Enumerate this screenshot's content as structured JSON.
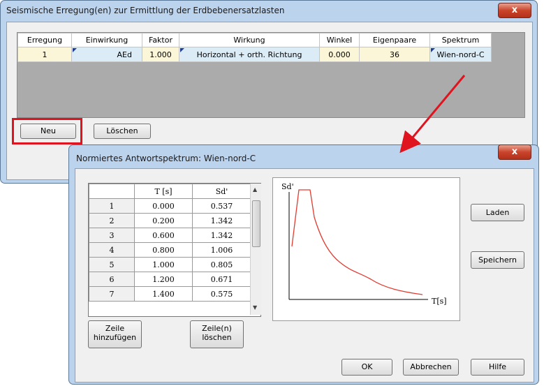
{
  "main_window": {
    "title": "Seismische Erregung(en) zur Ermittlung der Erdbebenersatzlasten",
    "close": "x",
    "columns": [
      "Erregung",
      "Einwirkung",
      "Faktor",
      "Wirkung",
      "Winkel",
      "Eigenpaare",
      "Spektrum"
    ],
    "row": [
      "1",
      "AEd",
      "1.000",
      "Horizontal + orth. Richtung",
      "0.000",
      "36",
      "Wien-nord-C"
    ],
    "buttons": {
      "new": "Neu",
      "delete": "Löschen"
    }
  },
  "dialog": {
    "title": "Normiertes Antwortspektrum: Wien-nord-C",
    "close": "x",
    "table": {
      "headers": [
        "",
        "T [s]",
        "Sd'"
      ],
      "rows": [
        [
          "1",
          "0.000",
          "0.537"
        ],
        [
          "2",
          "0.200",
          "1.342"
        ],
        [
          "3",
          "0.600",
          "1.342"
        ],
        [
          "4",
          "0.800",
          "1.006"
        ],
        [
          "5",
          "1.000",
          "0.805"
        ],
        [
          "6",
          "1.200",
          "0.671"
        ],
        [
          "7",
          "1.400",
          "0.575"
        ]
      ]
    },
    "buttons": {
      "add_row": "Zeile hinzufügen",
      "delete_rows": "Zeile(n) löschen",
      "load": "Laden",
      "save": "Speichern",
      "ok": "OK",
      "cancel": "Abbrechen",
      "help": "Hilfe"
    },
    "chart": {
      "ylabel": "Sd'",
      "xlabel": "T[s]",
      "line_color": "#e03c31"
    }
  },
  "colors": {
    "highlight_box": "#e0141e",
    "arrow": "#e0141e"
  }
}
